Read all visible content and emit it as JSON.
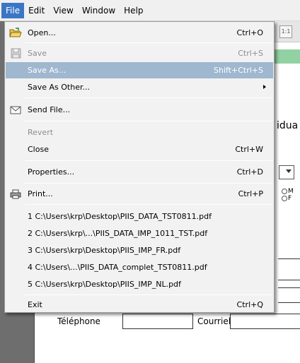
{
  "menubar": {
    "items": [
      "File",
      "Edit",
      "View",
      "Window",
      "Help"
    ]
  },
  "background": {
    "partial_text": "idua",
    "radio_m": "M",
    "radio_f": "F",
    "telephone_label": "Téléphone",
    "courriel_label": "Courriel",
    "toolbar_badge": "1:1"
  },
  "file_menu": {
    "open": {
      "label": "Open...",
      "shortcut": "Ctrl+O"
    },
    "save": {
      "label": "Save",
      "shortcut": "Ctrl+S"
    },
    "save_as": {
      "label": "Save As...",
      "shortcut": "Shift+Ctrl+S"
    },
    "save_as_other": {
      "label": "Save As Other..."
    },
    "send_file": {
      "label": "Send File..."
    },
    "revert": {
      "label": "Revert"
    },
    "close": {
      "label": "Close",
      "shortcut": "Ctrl+W"
    },
    "properties": {
      "label": "Properties...",
      "shortcut": "Ctrl+D"
    },
    "print": {
      "label": "Print...",
      "shortcut": "Ctrl+P"
    },
    "recent": [
      "1 C:\\Users\\krp\\Desktop\\PIIS_DATA_TST0811.pdf",
      "2 C:\\Users\\krp\\...\\PIIS_DATA_IMP_1011_TST.pdf",
      "3 C:\\Users\\krp\\Desktop\\PIIS_IMP_FR.pdf",
      "4 C:\\Users\\...\\PIIS_DATA_complet_TST0811.pdf",
      "5 C:\\Users\\krp\\Desktop\\PIIS_IMP_NL.pdf"
    ],
    "exit": {
      "label": "Exit",
      "shortcut": "Ctrl+Q"
    }
  },
  "colors": {
    "menu_highlight": "#9fb7cf",
    "menubar_active": "#3a76c4",
    "form_green_bar": "#92d2a2"
  }
}
